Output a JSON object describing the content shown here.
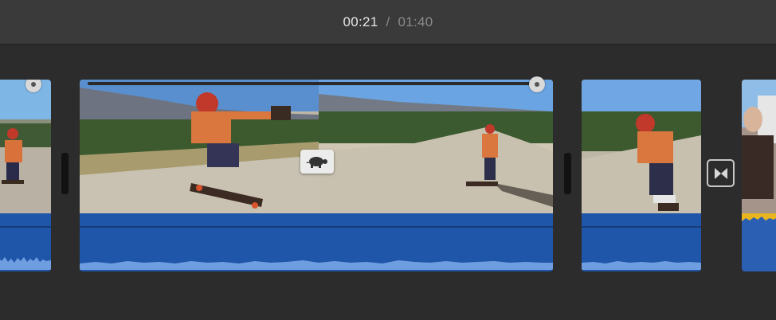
{
  "header": {
    "current_time": "00:21",
    "separator": "/",
    "duration": "01:40"
  },
  "clips": [
    {
      "id": "clip-left-partial",
      "kind": "video"
    },
    {
      "id": "clip-slow-motion",
      "kind": "video",
      "speed": "slow"
    },
    {
      "id": "clip-middle",
      "kind": "video"
    },
    {
      "id": "clip-right-partial",
      "kind": "video"
    }
  ],
  "icons": {
    "speed_indicator": "turtle-icon",
    "transition": "bowtie-transition-icon",
    "speed_slider_knob": "slider-knob-icon"
  },
  "colors": {
    "audio_track": "#1f56aa",
    "waveform": "#6f9ee0",
    "background": "#2c2c2c",
    "header_bg": "#3a3a3a"
  }
}
